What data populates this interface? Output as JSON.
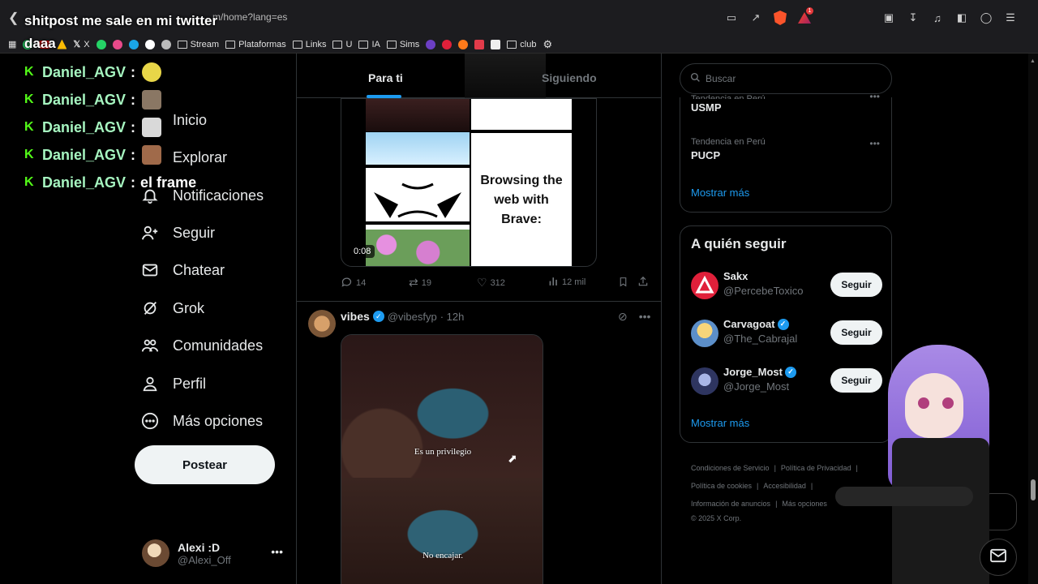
{
  "browser": {
    "url_fragment": "m/home?lang=es",
    "bookmarks": [
      "X",
      "Stream",
      "Plataformas",
      "Links",
      "U",
      "IA",
      "Sims",
      "club"
    ],
    "notification_count": "1"
  },
  "overlay": {
    "title": "shitpost me sale en mi twitter daaa",
    "chat": [
      {
        "user": "Daniel_AGV",
        "message": "",
        "emote_color": "#e8d648"
      },
      {
        "user": "Daniel_AGV",
        "message": "",
        "emote_color": "#8a7764"
      },
      {
        "user": "Daniel_AGV",
        "message": "",
        "emote_color": "#d9d9d9"
      },
      {
        "user": "Daniel_AGV",
        "message": "",
        "emote_color": "#a06a4a"
      },
      {
        "user": "Daniel_AGV",
        "message": "el frame",
        "emote_color": ""
      }
    ]
  },
  "nav": {
    "items": [
      {
        "label": "Inicio",
        "icon": "home-icon"
      },
      {
        "label": "Explorar",
        "icon": "search-icon"
      },
      {
        "label": "Notificaciones",
        "icon": "bell-icon"
      },
      {
        "label": "Seguir",
        "icon": "add-person-icon"
      },
      {
        "label": "Chatear",
        "icon": "mail-icon"
      },
      {
        "label": "Grok",
        "icon": "grok-icon"
      },
      {
        "label": "Comunidades",
        "icon": "communities-icon"
      },
      {
        "label": "Perfil",
        "icon": "person-icon"
      },
      {
        "label": "Más opciones",
        "icon": "more-circle-icon"
      }
    ],
    "post_label": "Postear"
  },
  "account": {
    "name": "Alexi :D",
    "handle": "@Alexi_Off"
  },
  "feed": {
    "tabs": [
      "Para ti",
      "Siguiendo"
    ],
    "active_tab": "Para ti",
    "tweet1": {
      "video_card_text": "Browsing the web with Brave:",
      "duration": "0:08",
      "replies": "14",
      "retweets": "19",
      "likes": "312",
      "views": "12 mil"
    },
    "tweet2": {
      "name": "vibes",
      "handle": "@vibesfyp",
      "time": "· 12h",
      "subtitle_top": "Es un privilegio",
      "subtitle_bottom": "No encajar."
    }
  },
  "right": {
    "search_placeholder": "Buscar",
    "trends": [
      {
        "context": "Tendencia en Perú",
        "name": "USMP"
      },
      {
        "context": "Tendencia en Perú",
        "name": "PUCP"
      }
    ],
    "trends_show_more": "Mostrar más",
    "follow_title": "A quién seguir",
    "follow": [
      {
        "name": "Sakx",
        "handle": "@PercebeToxico",
        "verified": false,
        "button": "Seguir",
        "avatar_color": "#e0203a"
      },
      {
        "name": "Carvagoat",
        "handle": "@The_Cabrajal",
        "verified": true,
        "button": "Seguir",
        "avatar_color": "#f2c063"
      },
      {
        "name": "Jorge_Most",
        "handle": "@Jorge_Most",
        "verified": true,
        "button": "Seguir",
        "avatar_color": "#3e4a80"
      }
    ],
    "follow_show_more": "Mostrar más",
    "footer": {
      "terms": "Condiciones de Servicio",
      "privacy": "Política de Privacidad",
      "cookies": "Política de cookies",
      "accessibility": "Accesibilidad",
      "ads": "Información de anuncios",
      "more": "Más opciones",
      "copyright": "© 2025 X Corp."
    }
  },
  "colors": {
    "accent": "#1d9bf0",
    "kick_green": "#53fc18"
  }
}
